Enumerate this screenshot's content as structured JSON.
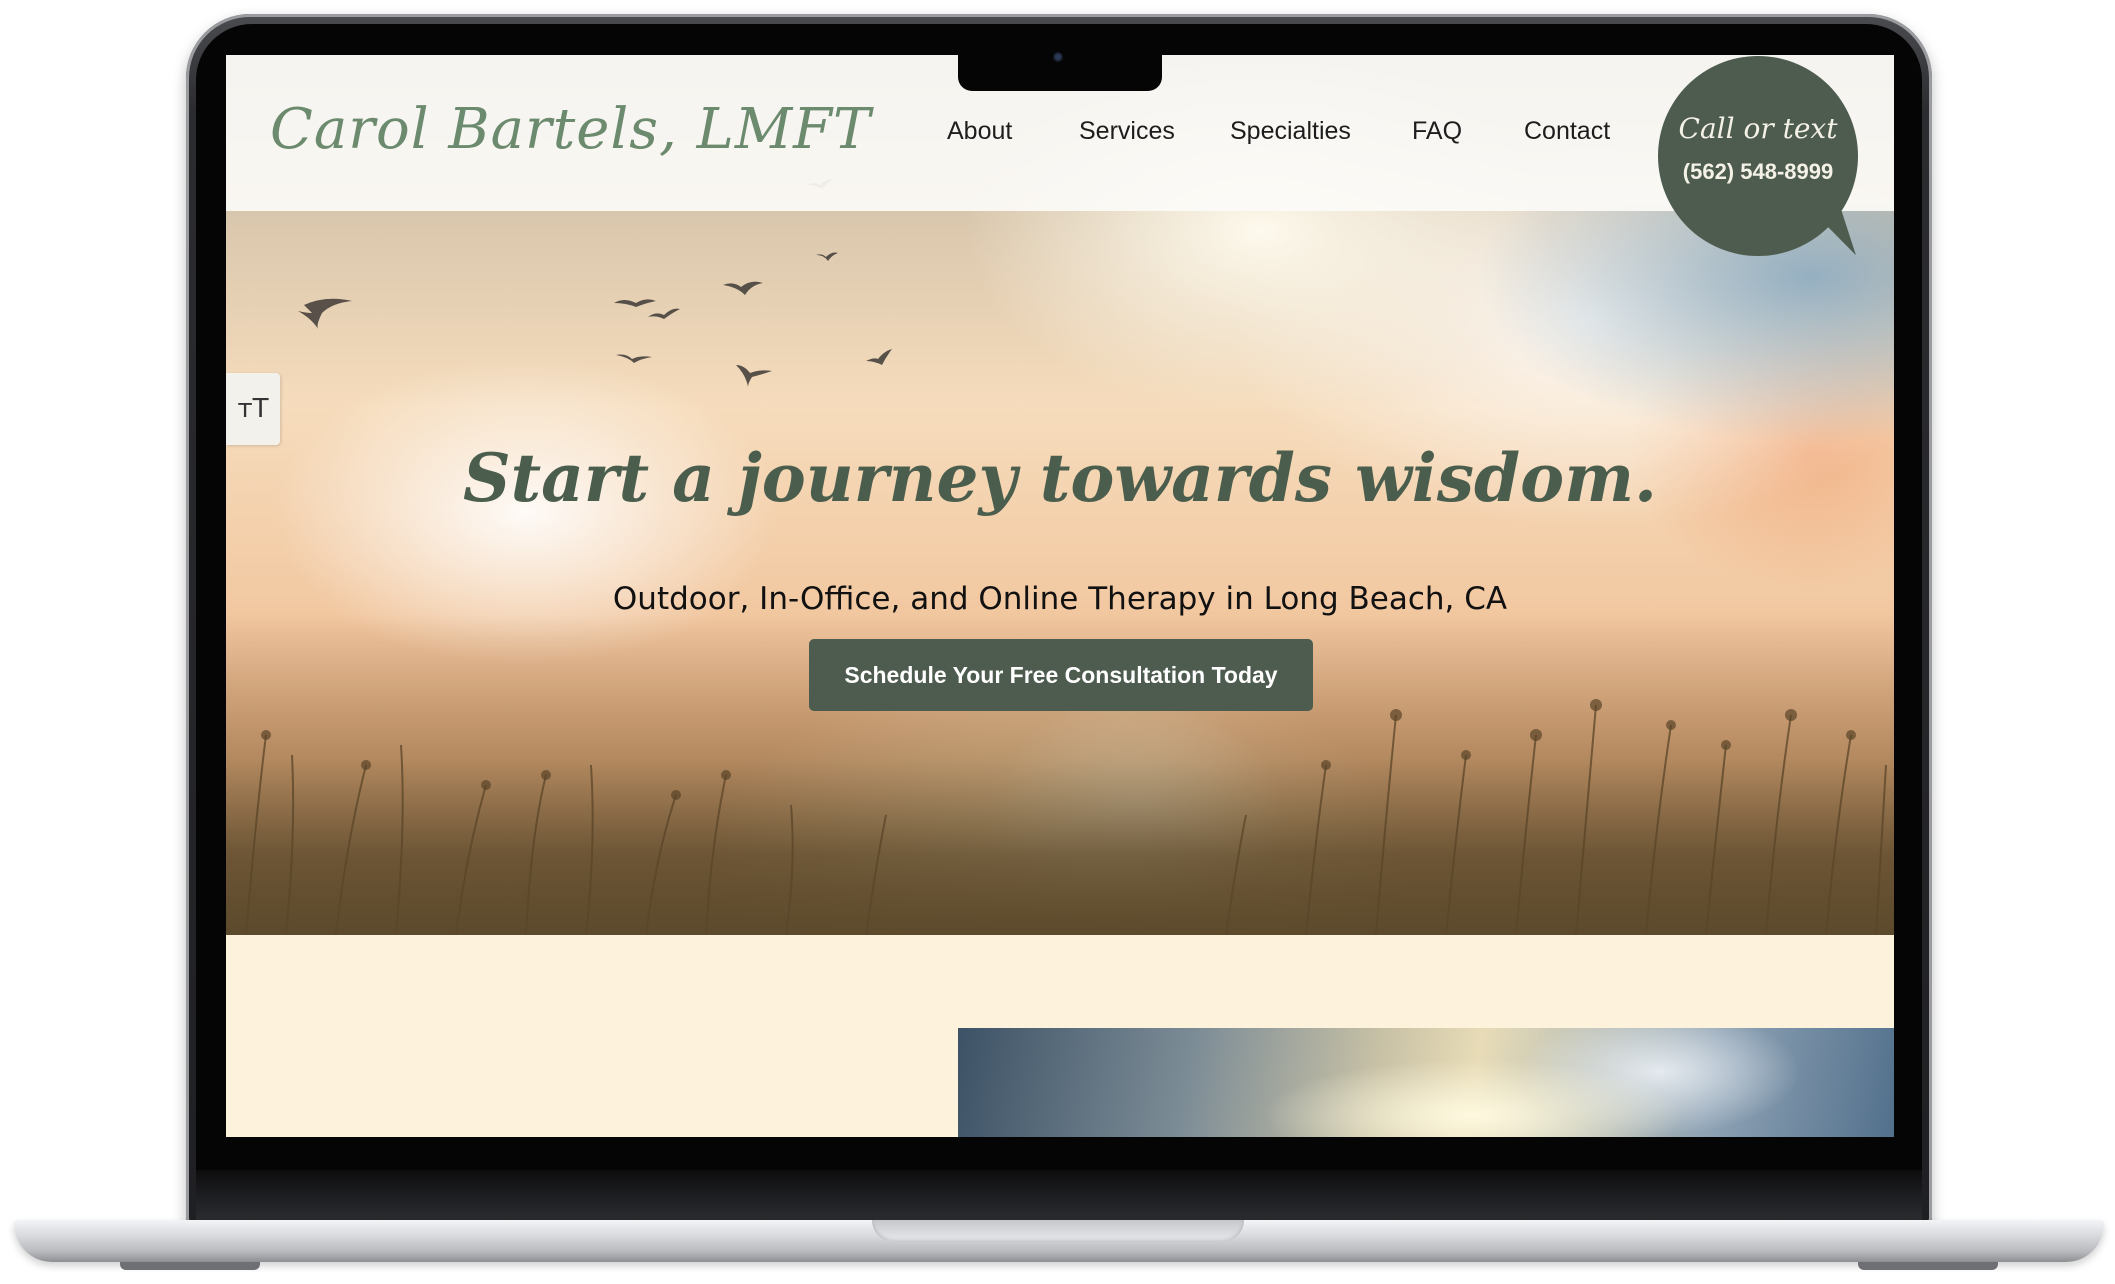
{
  "site": {
    "logo_text": "Carol Bartels, LMFT",
    "nav": [
      {
        "label": "About"
      },
      {
        "label": "Services"
      },
      {
        "label": "Specialties"
      },
      {
        "label": "FAQ"
      },
      {
        "label": "Contact"
      }
    ],
    "call_bubble": {
      "line1": "Call or text",
      "phone": "(562) 548-8999"
    },
    "accessibility_button": {
      "icon": "text-size-icon",
      "glyph": "ᴛT"
    }
  },
  "hero": {
    "headline": "Start a journey towards wisdom.",
    "subheadline": "Outdoor, In-Office, and Online Therapy in Long Beach, CA",
    "cta_label": "Schedule Your Free Consultation Today"
  },
  "colors": {
    "brand_green": "#4d5c4f",
    "logo_green": "#6b8a6e",
    "section_background": "#fdf3dc"
  }
}
